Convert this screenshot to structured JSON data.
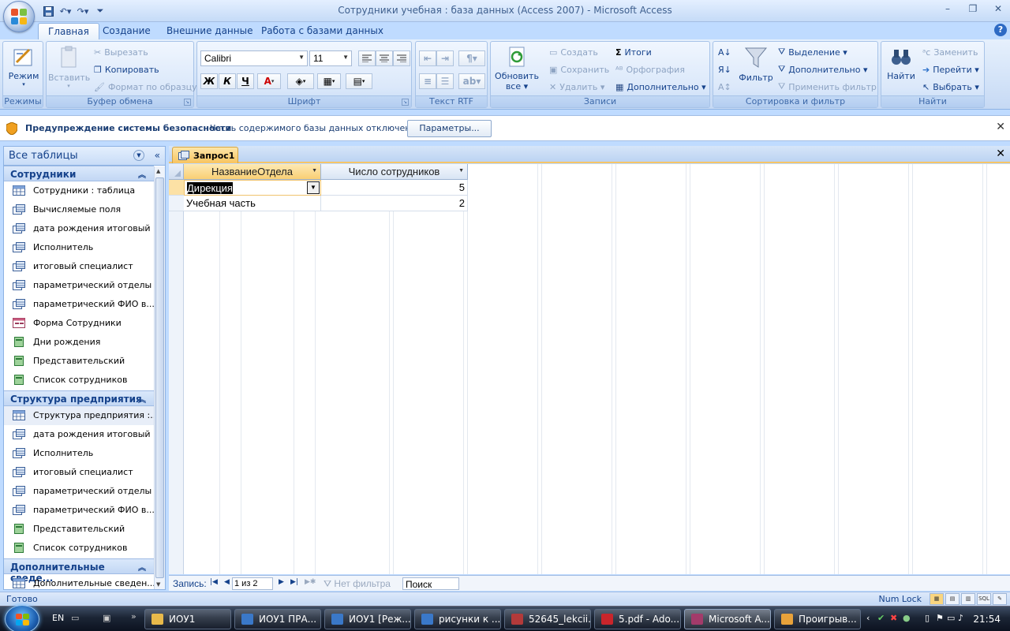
{
  "window": {
    "title": "Сотрудники учебная : база данных (Access 2007) - Microsoft Access"
  },
  "ribbon": {
    "tabs": [
      "Главная",
      "Создание",
      "Внешние данные",
      "Работа с базами данных"
    ],
    "views": {
      "mode_label": "Режим",
      "group": "Режимы"
    },
    "clipboard": {
      "paste": "Вставить",
      "cut": "Вырезать",
      "copy": "Копировать",
      "format_painter": "Формат по образцу",
      "group": "Буфер обмена"
    },
    "font": {
      "name": "Calibri",
      "size": "11",
      "bold": "Ж",
      "italic": "К",
      "underline": "Ч",
      "group": "Шрифт"
    },
    "rtf": {
      "group": "Текст RTF"
    },
    "records": {
      "refresh": "Обновить",
      "refresh2": "все ▾",
      "new": "Создать",
      "save": "Сохранить",
      "delete": "Удалить ▾",
      "totals": "Итоги",
      "spelling": "Орфография",
      "more": "Дополнительно ▾",
      "group": "Записи"
    },
    "sort": {
      "filter": "Фильтр",
      "selection": "Выделение ▾",
      "advanced": "Дополнительно ▾",
      "toggle": "Применить фильтр",
      "group": "Сортировка и фильтр"
    },
    "find": {
      "find": "Найти",
      "replace": "Заменить",
      "goto": "Перейти ▾",
      "select": "Выбрать ▾",
      "group": "Найти"
    }
  },
  "security": {
    "title": "Предупреждение системы безопасности",
    "message": "Часть содержимого базы данных отключено",
    "button": "Параметры..."
  },
  "nav": {
    "header": "Все таблицы",
    "sections": [
      {
        "title": "Сотрудники",
        "items": [
          {
            "label": "Сотрудники : таблица",
            "icon": "table"
          },
          {
            "label": "Вычисляемые поля",
            "icon": "query"
          },
          {
            "label": "дата рождения итоговый",
            "icon": "query"
          },
          {
            "label": "Исполнитель",
            "icon": "query"
          },
          {
            "label": "итоговый специалист",
            "icon": "query"
          },
          {
            "label": "параметрический отделы",
            "icon": "query"
          },
          {
            "label": "параметрический ФИО в...",
            "icon": "query"
          },
          {
            "label": "Форма Сотрудники",
            "icon": "form"
          },
          {
            "label": "Дни рождения",
            "icon": "report"
          },
          {
            "label": "Представительский",
            "icon": "report"
          },
          {
            "label": "Список сотрудников",
            "icon": "report"
          }
        ]
      },
      {
        "title": "Структура предприятия",
        "items": [
          {
            "label": "Структура предприятия :...",
            "icon": "table"
          },
          {
            "label": "дата рождения итоговый",
            "icon": "query"
          },
          {
            "label": "Исполнитель",
            "icon": "query"
          },
          {
            "label": "итоговый специалист",
            "icon": "query"
          },
          {
            "label": "параметрический отделы",
            "icon": "query"
          },
          {
            "label": "параметрический ФИО в...",
            "icon": "query"
          },
          {
            "label": "Представительский",
            "icon": "report"
          },
          {
            "label": "Список сотрудников",
            "icon": "report"
          }
        ]
      },
      {
        "title": "Дополнительные сведе...",
        "items": [
          {
            "label": "Дополнительные сведен...",
            "icon": "table"
          }
        ]
      }
    ]
  },
  "document": {
    "tab": "Запрос1",
    "columns": [
      "НазваниеОтдела",
      "Число сотрудников"
    ],
    "rows": [
      [
        "Дирекция",
        "5"
      ],
      [
        "Учебная часть",
        "2"
      ]
    ]
  },
  "recnav": {
    "label": "Запись:",
    "position": "1 из 2",
    "filter": "Нет фильтра",
    "search": "Поиск"
  },
  "status": {
    "left": "Готово",
    "right": "Num Lock"
  },
  "taskbar": {
    "lang": "EN",
    "buttons": [
      "ИОУ1",
      "ИОУ1 ПРА...",
      "ИОУ1 [Реж...",
      "рисунки к ...",
      "52645_lekcii...",
      "5.pdf - Ado...",
      "Microsoft A...",
      "Проигрыв..."
    ],
    "clock": "21:54"
  }
}
